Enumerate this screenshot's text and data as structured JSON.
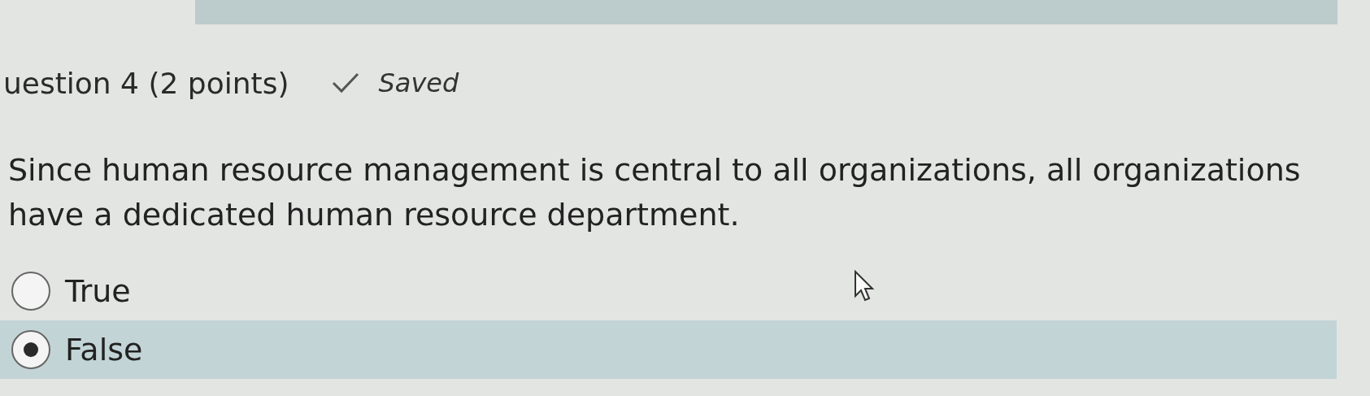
{
  "question": {
    "title": "uestion 4 (2 points)",
    "status": "Saved",
    "saved": true,
    "text": "Since human resource management is central to all organizations, all organizations have a dedicated human resource department.",
    "options": [
      {
        "label": "True",
        "selected": false
      },
      {
        "label": "False",
        "selected": true
      }
    ]
  }
}
